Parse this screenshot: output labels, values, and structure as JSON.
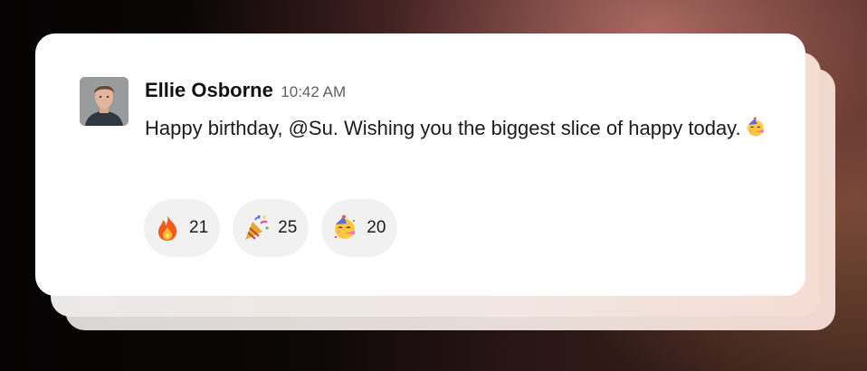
{
  "message": {
    "author": "Ellie Osborne",
    "time": "10:42 AM",
    "text": "Happy birthday, @Su. Wishing you the biggest slice of happy today.",
    "trailing_emoji": "partying-face-icon"
  },
  "reactions": [
    {
      "icon": "fire-icon",
      "count": "21"
    },
    {
      "icon": "party-popper-icon",
      "count": "25"
    },
    {
      "icon": "partying-face-icon",
      "count": "20"
    }
  ]
}
